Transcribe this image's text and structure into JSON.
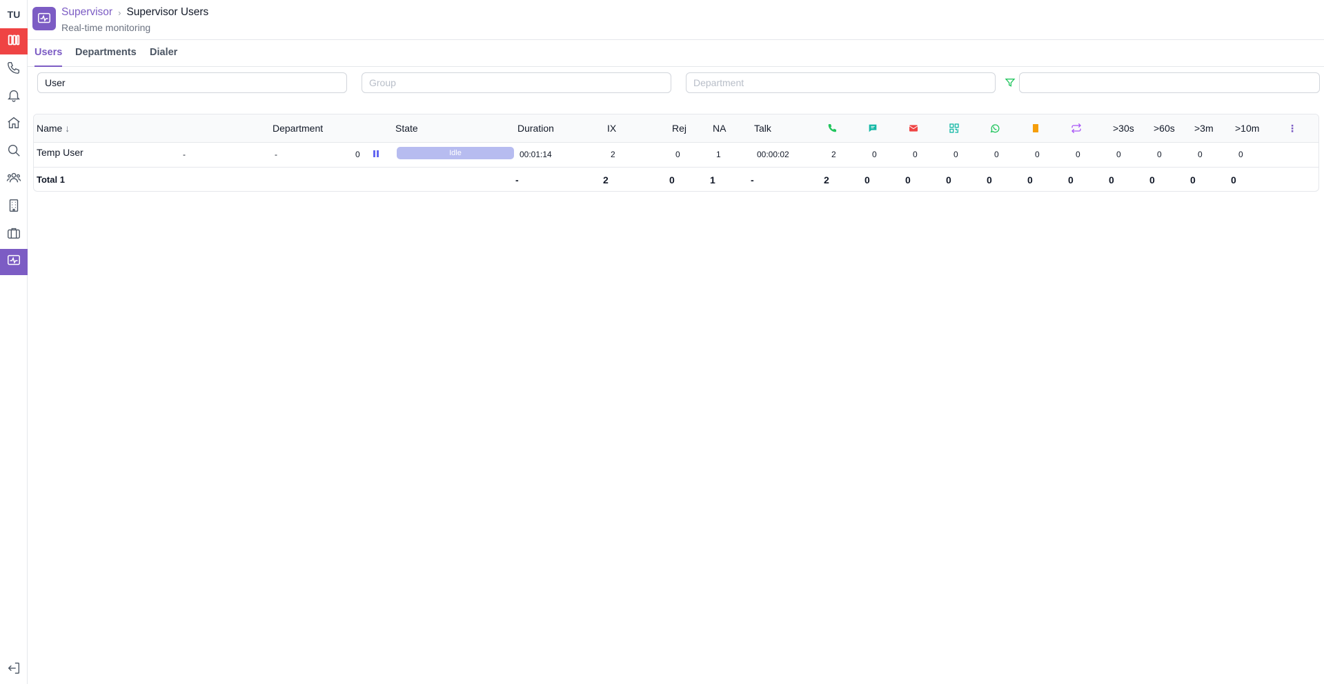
{
  "sidebar": {
    "avatar_initials": "TU",
    "items": [
      {
        "name": "columns-icon",
        "state": "red"
      },
      {
        "name": "phone-icon"
      },
      {
        "name": "bell-icon"
      },
      {
        "name": "home-icon"
      },
      {
        "name": "search-icon"
      },
      {
        "name": "users-icon"
      },
      {
        "name": "building-icon"
      },
      {
        "name": "briefcase-icon"
      },
      {
        "name": "activity-monitor-icon",
        "state": "active"
      },
      {
        "name": "logout-icon"
      }
    ]
  },
  "header": {
    "breadcrumb_parent": "Supervisor",
    "breadcrumb_current": "Supervisor Users",
    "subtitle": "Real-time monitoring"
  },
  "tabs": [
    {
      "label": "Users",
      "active": true
    },
    {
      "label": "Departments",
      "active": false
    },
    {
      "label": "Dialer",
      "active": false
    }
  ],
  "filters": {
    "user": {
      "value": "User",
      "placeholder": ""
    },
    "group": {
      "value": "",
      "placeholder": "Group"
    },
    "department": {
      "value": "",
      "placeholder": "Department"
    },
    "search": {
      "value": "",
      "placeholder": ""
    }
  },
  "table": {
    "headers": {
      "name": "Name",
      "department": "Department",
      "state": "State",
      "duration": "Duration",
      "ix": "IX",
      "rej": "Rej",
      "na": "NA",
      "talk": "Talk",
      "gt30s": ">30s",
      "gt60s": ">60s",
      "gt3m": ">3m",
      "gt10m": ">10m"
    },
    "channel_icons": [
      {
        "name": "phone-channel-icon",
        "color": "#22c55e"
      },
      {
        "name": "chat-channel-icon",
        "color": "#14b8a6"
      },
      {
        "name": "email-channel-icon",
        "color": "#ef4444"
      },
      {
        "name": "qr-channel-icon",
        "color": "#14b8a6"
      },
      {
        "name": "whatsapp-channel-icon",
        "color": "#22c55e"
      },
      {
        "name": "note-channel-icon",
        "color": "#f59e0b"
      },
      {
        "name": "transfer-channel-icon",
        "color": "#a855f7"
      }
    ],
    "row": {
      "name": "Temp User",
      "group": "-",
      "department": "-",
      "count": "0",
      "state": "Idle",
      "duration": "00:01:14",
      "ix": "2",
      "rej": "0",
      "na": "1",
      "talk": "00:00:02",
      "channels": [
        "2",
        "0",
        "0",
        "0",
        "0",
        "0",
        "0"
      ],
      "thresholds": [
        "0",
        "0",
        "0",
        "0"
      ]
    },
    "total": {
      "label": "Total 1",
      "duration": "-",
      "ix": "2",
      "rej": "0",
      "na": "1",
      "talk": "-",
      "channels": [
        "2",
        "0",
        "0",
        "0",
        "0",
        "0",
        "0"
      ],
      "thresholds": [
        "0",
        "0",
        "0",
        "0"
      ]
    }
  }
}
